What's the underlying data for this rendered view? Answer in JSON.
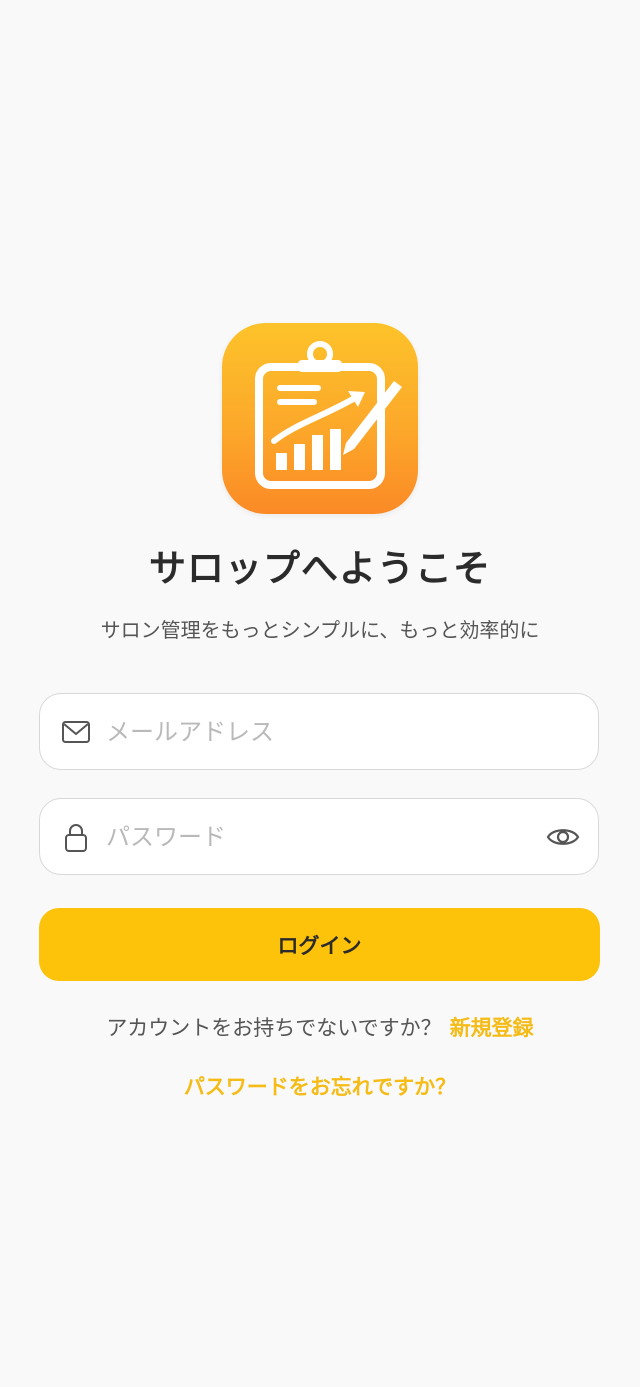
{
  "app": {
    "icon": "clipboard-chart-icon",
    "title": "サロップへようこそ",
    "subtitle": "サロン管理をもっとシンプルに、もっと効率的に"
  },
  "form": {
    "email": {
      "icon": "mail-icon",
      "placeholder": "メールアドレス",
      "value": ""
    },
    "password": {
      "icon": "lock-icon",
      "placeholder": "パスワード",
      "value": "",
      "toggle_icon": "eye-icon"
    },
    "login_label": "ログイン"
  },
  "footer": {
    "signup_prompt": "アカウントをお持ちでないですか？",
    "signup_link": "新規登録",
    "forgot_link": "パスワードをお忘れですか？"
  },
  "colors": {
    "background": "#f9f9f9",
    "accent": "#fdc20a",
    "link": "#f5bb16",
    "icon_gradient_top": "#fdc32a",
    "icon_gradient_bottom": "#fb8a26"
  }
}
